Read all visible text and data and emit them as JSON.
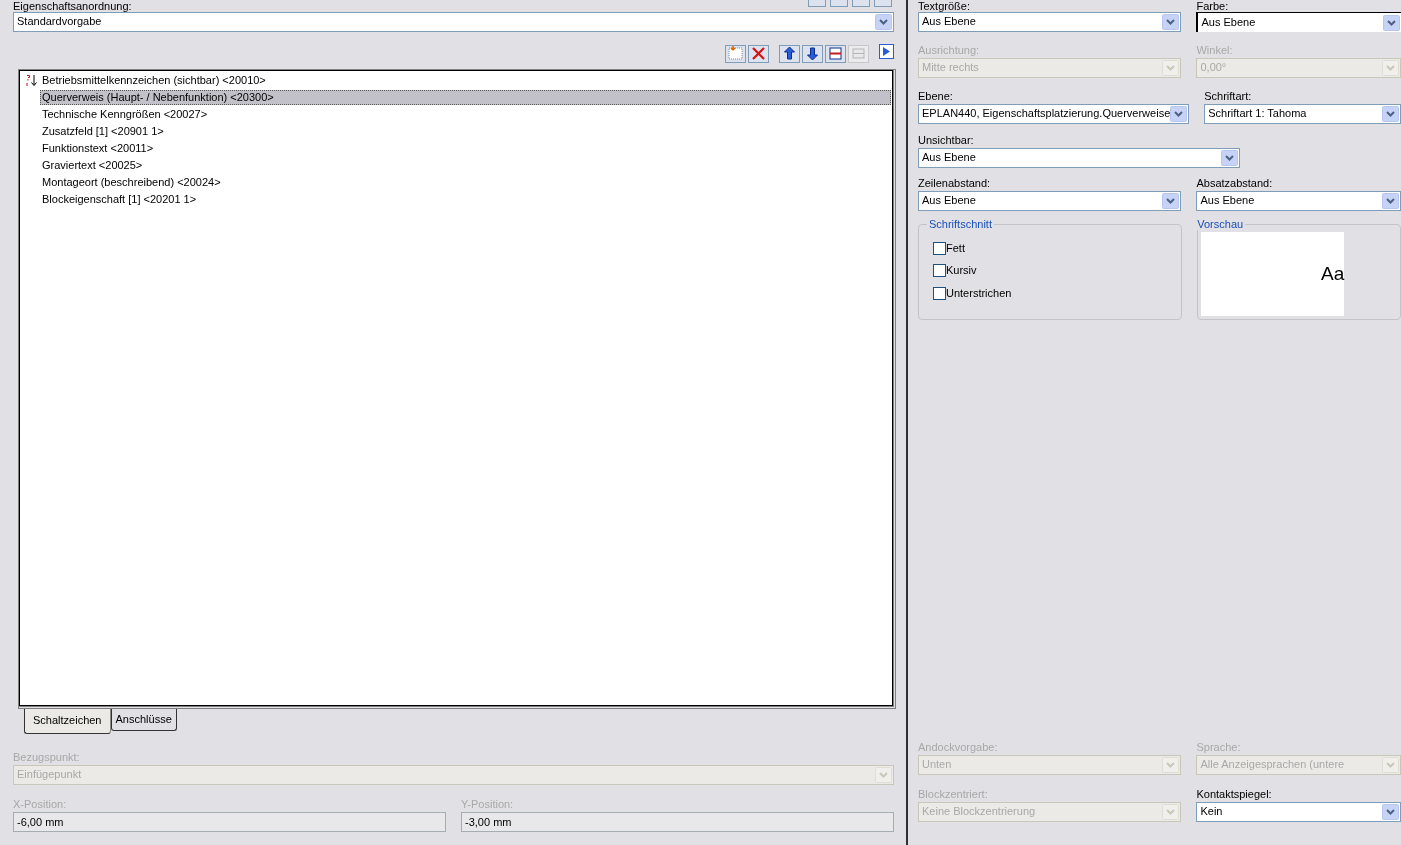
{
  "arrangement": {
    "label": "Eigenschaftsanordnung:",
    "value": "Standardvorgabe"
  },
  "top_toolbar": [
    {
      "kind": "blank"
    },
    {
      "kind": "blank"
    },
    {
      "kind": "blank"
    },
    {
      "kind": "blank"
    }
  ],
  "toolbar": [
    {
      "kind": "new",
      "disabled": false
    },
    {
      "kind": "delete",
      "disabled": false
    },
    {
      "kind": "up",
      "disabled": false
    },
    {
      "kind": "down",
      "disabled": false
    },
    {
      "kind": "insert",
      "disabled": false
    },
    {
      "kind": "remove",
      "disabled": true
    },
    {
      "kind": "more",
      "disabled": false
    }
  ],
  "properties": [
    {
      "label": "Betriebsmittelkennzeichen (sichtbar) <20010>",
      "selected": false,
      "kind": "sort"
    },
    {
      "label": "Querverweis (Haupt- / Nebenfunktion) <20300>",
      "selected": true,
      "kind": "plain"
    },
    {
      "label": "Technische Kenngrößen <20027>",
      "selected": false,
      "kind": "plain"
    },
    {
      "label": "Zusatzfeld [1] <20901 1>",
      "selected": false,
      "kind": "plain"
    },
    {
      "label": "Funktionstext <20011>",
      "selected": false,
      "kind": "plain"
    },
    {
      "label": "Graviertext <20025>",
      "selected": false,
      "kind": "plain"
    },
    {
      "label": "Montageort (beschreibend) <20024>",
      "selected": false,
      "kind": "plain"
    },
    {
      "label": "Blockeigenschaft [1] <20201 1>",
      "selected": false,
      "kind": "plain"
    }
  ],
  "tabs": [
    {
      "label": "Schaltzeichen",
      "selected": true
    },
    {
      "label": "Anschlüsse",
      "selected": false
    }
  ],
  "reference_point": {
    "label": "Bezugspunkt:",
    "value": "Einfügepunkt",
    "disabled": true
  },
  "positions": [
    {
      "label": "X-Position:",
      "value": "-6,00 mm",
      "disabled": true
    },
    {
      "label": "Y-Position:",
      "value": "-3,00 mm",
      "disabled": true
    }
  ],
  "format_rows": [
    [
      {
        "label": "Textgröße:",
        "value": "Aus Ebene",
        "disabled": false
      },
      {
        "label": "Farbe:",
        "value": "Aus Ebene",
        "disabled": false
      }
    ],
    [
      {
        "label": "Ausrichtung:",
        "value": "Mitte rechts",
        "disabled": true
      },
      {
        "label": "Winkel:",
        "value": "0,00°",
        "disabled": true
      }
    ],
    [
      {
        "label": "Ebene:",
        "value": "EPLAN440, Eigenschaftsplatzierung.Querverweise",
        "disabled": false
      },
      {
        "label": "Schriftart:",
        "value": "Schriftart 1: Tahoma",
        "disabled": false
      }
    ],
    [
      {
        "label": "Unsichtbar:",
        "value": "Aus Ebene",
        "disabled": false
      }
    ],
    [
      {
        "label": "Zeilenabstand:",
        "value": "Aus Ebene",
        "disabled": false
      },
      {
        "label": "Absatzabstand:",
        "value": "Aus Ebene",
        "disabled": false
      }
    ]
  ],
  "font_style": {
    "title": "Schriftschnitt",
    "options": [
      {
        "label": "Fett",
        "checked": false
      },
      {
        "label": "Kursiv",
        "checked": false
      },
      {
        "label": "Unterstrichen",
        "checked": false
      }
    ]
  },
  "preview": {
    "title": "Vorschau",
    "sample": "Aa"
  },
  "bottom_rows": [
    [
      {
        "label": "Andockvorgabe:",
        "value": "Unten",
        "disabled": true
      },
      {
        "label": "Sprache:",
        "value": "Alle Anzeigesprachen (untere",
        "disabled": true
      }
    ],
    [
      {
        "label": "Blockzentriert:",
        "value": "Keine Blockzentrierung",
        "disabled": true
      },
      {
        "label": "Kontaktspiegel:",
        "value": "Kein",
        "disabled": false
      }
    ]
  ]
}
